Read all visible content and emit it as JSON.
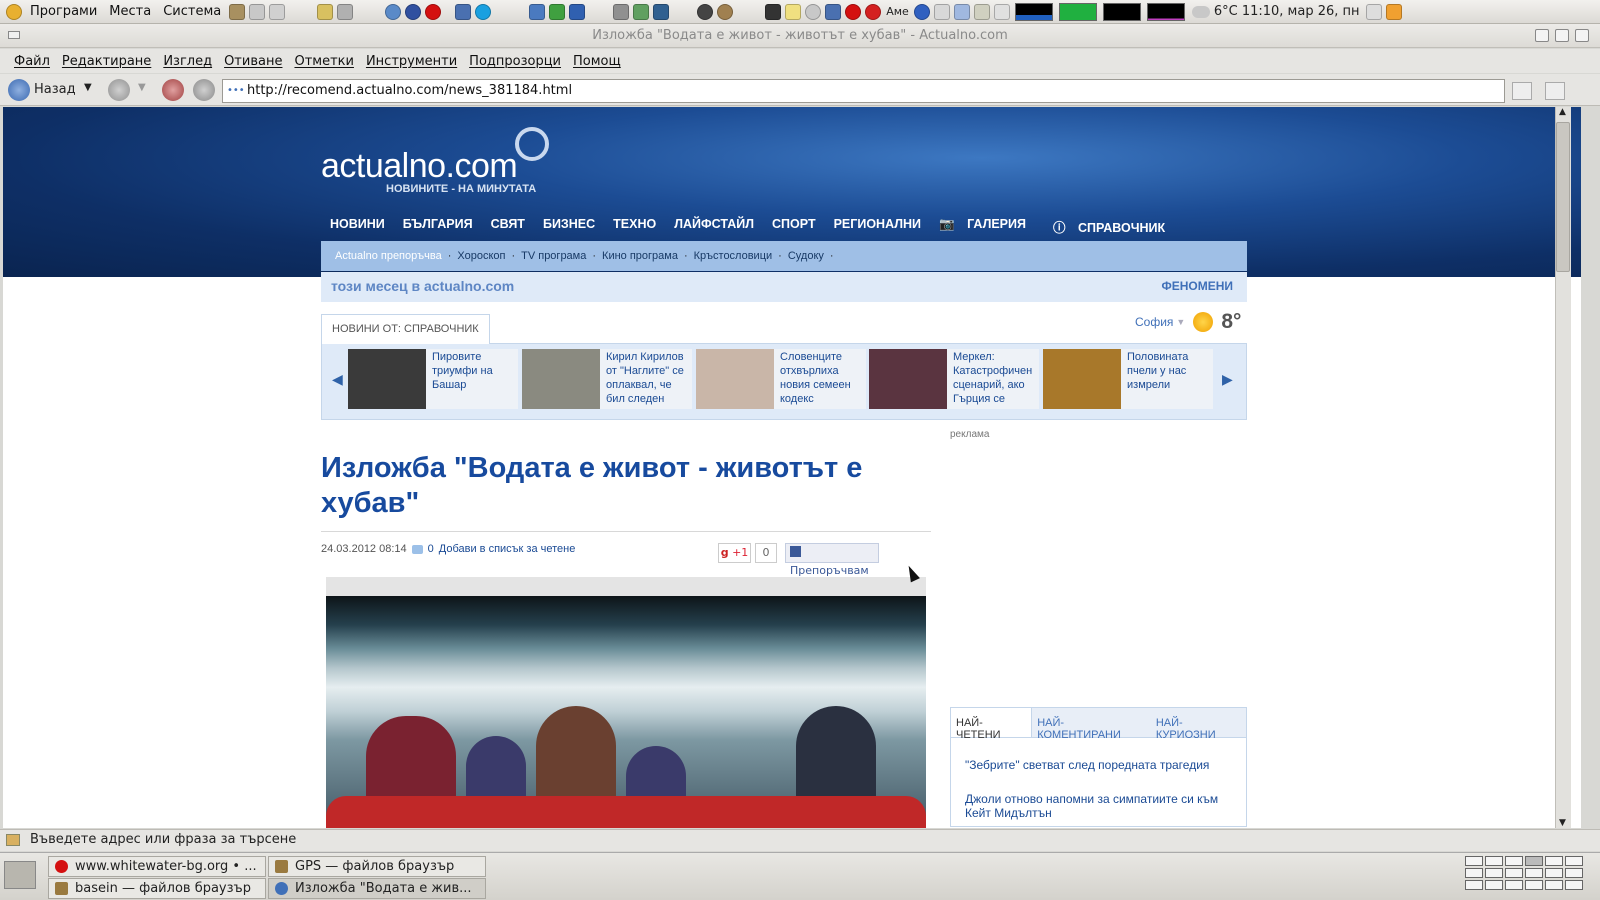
{
  "panel": {
    "menus": [
      "Програми",
      "Места",
      "Система"
    ],
    "weather_temp": "6°C",
    "clock": "11:10, мар 26, пн",
    "keyboard": "Аме"
  },
  "window": {
    "title": "Изложба \"Водата е живот - животът е хубав\" - Actualno.com"
  },
  "menubar": [
    "Файл",
    "Редактиране",
    "Изглед",
    "Отиване",
    "Отметки",
    "Инструменти",
    "Подпрозорци",
    "Помощ"
  ],
  "toolbar": {
    "back_label": "Назад",
    "url": "http://recomend.actualno.com/news_381184.html"
  },
  "site": {
    "logo": "actualno.com",
    "tagline": "НОВИНИТЕ - НА МИНУТАТА",
    "nav": [
      "НОВИНИ",
      "БЪЛГАРИЯ",
      "СВЯТ",
      "БИЗНЕС",
      "ТЕХНО",
      "ЛАЙФСТАЙЛ",
      "СПОРТ",
      "РЕГИОНАЛНИ",
      "ГАЛЕРИЯ",
      "СПРАВОЧНИК"
    ],
    "subnav": [
      "Actualno препоръчва",
      "Хороскоп",
      "TV програма",
      "Кино програма",
      "Кръстословици",
      "Судоку"
    ],
    "month_label": "този месец в actualno.com",
    "month_link": "ФЕНОМЕНИ",
    "news_tab": "НОВИНИ ОТ: СПРАВОЧНИК",
    "weather": {
      "city": "София",
      "temp": "8°"
    },
    "carousel": [
      {
        "text": "Пировите триумфи на Башар",
        "color": "#3a3a3a"
      },
      {
        "text": "Кирил Кирилов от \"Наглите\" се оплаквал, че бил следен",
        "color": "#8a8a80"
      },
      {
        "text": "Словенците отхвърлиха новия семеен кодекс",
        "color": "#c9b6a8"
      },
      {
        "text": "Меркел: Катастрофичен сценарий, ако Гърция се",
        "color": "#5a3440"
      },
      {
        "text": "Половината пчели у нас измрели",
        "color": "#a8782a"
      }
    ],
    "ad_label": "реклама"
  },
  "article": {
    "title": "Изложба \"Водата е живот - животът е хубав\"",
    "date": "24.03.2012 08:14",
    "comments": "0",
    "reading_list": "Добави в списък за четене",
    "gplus": "+1",
    "gplus_count": "0",
    "fb": "Препоръчвам"
  },
  "sidebar": {
    "tabs": [
      "НАЙ-ЧЕТЕНИ",
      "НАЙ-КОМЕНТИРАНИ",
      "НАЙ-КУРИОЗНИ"
    ],
    "items": [
      "\"Зебрите\" светват след поредната трагедия",
      "Джоли отново напомни за симпатиите си към Кейт Мидълтън"
    ]
  },
  "statusbar": {
    "text": "Въведете адрес или фраза за търсене"
  },
  "taskbar": {
    "tasks": [
      {
        "label": "www.whitewater-bg.org • ...",
        "color": "#d41010"
      },
      {
        "label": "GPS — файлов браузър",
        "color": "#9a7a40"
      },
      {
        "label": "basein — файлов браузър",
        "color": "#9a7a40"
      },
      {
        "label": "Изложба \"Водата е жив...",
        "color": "#4070b8"
      }
    ]
  }
}
